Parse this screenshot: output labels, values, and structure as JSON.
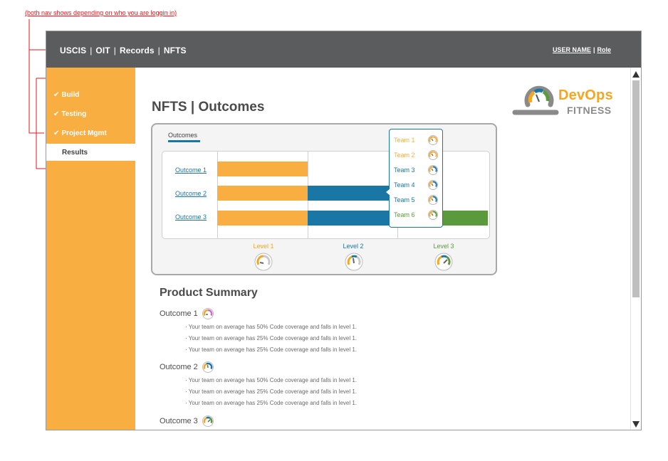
{
  "annotation": "(both nav shows depending on who you are loggin in)",
  "topbar": {
    "crumbs": [
      "USCIS",
      "OIT",
      "Records",
      "NFTS"
    ],
    "user_name": "USER NAME",
    "role": "Role"
  },
  "sidebar": {
    "items": [
      {
        "label": "Build",
        "checked": true
      },
      {
        "label": "Testing",
        "checked": true
      },
      {
        "label": "Project Mgmt",
        "checked": true
      },
      {
        "label": "Results",
        "checked": false,
        "active": true
      }
    ]
  },
  "logo": {
    "name": "DevOps",
    "sub": "FITNESS"
  },
  "page_title": "NFTS | Outcomes",
  "panel": {
    "tab_label": "Outcomes",
    "outcomes": [
      "Outcome 1",
      "Outcome 2",
      "Outcome 3"
    ],
    "levels": [
      "Level 1",
      "Level 2",
      "Level 3"
    ]
  },
  "chart_data": {
    "type": "bar",
    "categories": [
      "Outcome 1",
      "Outcome 2",
      "Outcome 3"
    ],
    "levels": [
      "Level 1",
      "Level 2",
      "Level 3"
    ],
    "values": [
      1,
      2,
      3
    ],
    "colors": {
      "level1": "#f9ae41",
      "level2": "#1a76a5",
      "level3": "#5b9a3c"
    }
  },
  "team_popup": {
    "teams": [
      {
        "label": "Team 1",
        "color": "#f9ae41"
      },
      {
        "label": "Team 2",
        "color": "#f9ae41"
      },
      {
        "label": "Team 3",
        "color": "#1a76a5"
      },
      {
        "label": "Team 4",
        "color": "#1a76a5"
      },
      {
        "label": "Team 5",
        "color": "#1a76a5"
      },
      {
        "label": "Team 6",
        "color": "#5b9a3c"
      }
    ]
  },
  "summary": {
    "title": "Product Summary",
    "outcomes": [
      {
        "label": "Outcome 1",
        "bullets": [
          "· Your team on average has 50% Code coverage and falls in level 1.",
          "· Your team on average has 25% Code coverage and falls in level 1.",
          "· Your team on average has 25% Code coverage and falls in level 1."
        ]
      },
      {
        "label": "Outcome 2",
        "bullets": [
          "· Your team on average has 50% Code coverage and falls in level 1.",
          "· Your team on average has 25% Code coverage and falls in level 1.",
          "· Your team on average has 25% Code coverage and falls in level 1."
        ]
      },
      {
        "label": "Outcome 3",
        "bullets": []
      }
    ]
  }
}
